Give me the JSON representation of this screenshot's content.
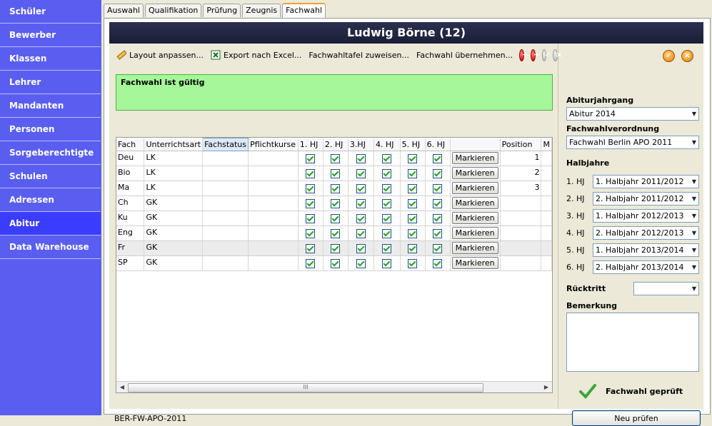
{
  "sidebar": {
    "items": [
      "Schüler",
      "Bewerber",
      "Klassen",
      "Lehrer",
      "Mandanten",
      "Personen",
      "Sorgeberechtigte",
      "Schulen",
      "Adressen",
      "Abitur",
      "Data Warehouse"
    ],
    "active_index": 9
  },
  "tabs": [
    "Auswahl",
    "Qualifikation",
    "Prüfung",
    "Zeugnis",
    "Fachwahl"
  ],
  "active_tab": "Fachwahl",
  "header": {
    "title": "Ludwig Börne (12)"
  },
  "toolbar": {
    "layout": "Layout anpassen...",
    "export": "Export nach Excel...",
    "assign": "Fachwahltafel zuweisen...",
    "apply": "Fachwahl übernehmen..."
  },
  "status": "Fachwahl ist gültig",
  "table": {
    "columns": [
      "Fach",
      "Unterrichtsart",
      "Fachstatus",
      "Pflichtkurse",
      "1. HJ",
      "2. HJ",
      "3.HJ",
      "4. HJ",
      "5. HJ",
      "6. HJ",
      "",
      "Position",
      "M"
    ],
    "button_label": "Markieren",
    "rows": [
      {
        "fach": "Deu",
        "art": "LK",
        "position": "1"
      },
      {
        "fach": "Bio",
        "art": "LK",
        "position": "2"
      },
      {
        "fach": "Ma",
        "art": "LK",
        "position": "3"
      },
      {
        "fach": "Ch",
        "art": "GK",
        "position": ""
      },
      {
        "fach": "Ku",
        "art": "GK",
        "position": ""
      },
      {
        "fach": "Eng",
        "art": "GK",
        "position": ""
      },
      {
        "fach": "Fr",
        "art": "GK",
        "position": ""
      },
      {
        "fach": "SP",
        "art": "GK",
        "position": ""
      }
    ],
    "scroll_grip": "III"
  },
  "footer_code": "BER-FW-APO-2011",
  "right": {
    "abiturjahrgang_label": "Abiturjahrgang",
    "abiturjahrgang_value": "Abitur 2014",
    "verordnung_label": "Fachwahlverordnung",
    "verordnung_value": "Fachwahl Berlin APO 2011",
    "halbjahre_label": "Halbjahre",
    "halbjahre": [
      {
        "label": "1. HJ",
        "value": "1. Halbjahr 2011/2012"
      },
      {
        "label": "2. HJ",
        "value": "2. Halbjahr 2011/2012"
      },
      {
        "label": "3. HJ",
        "value": "1. Halbjahr 2012/2013"
      },
      {
        "label": "4. HJ",
        "value": "2. Halbjahr 2012/2013"
      },
      {
        "label": "5. HJ",
        "value": "1. Halbjahr 2013/2014"
      },
      {
        "label": "6. HJ",
        "value": "2. Halbjahr 2013/2014"
      }
    ],
    "ruecktritt_label": "Rücktritt",
    "ruecktritt_value": "",
    "bemerkung_label": "Bemerkung",
    "geprueft": "Fachwahl geprüft",
    "button": "Neu prüfen"
  }
}
